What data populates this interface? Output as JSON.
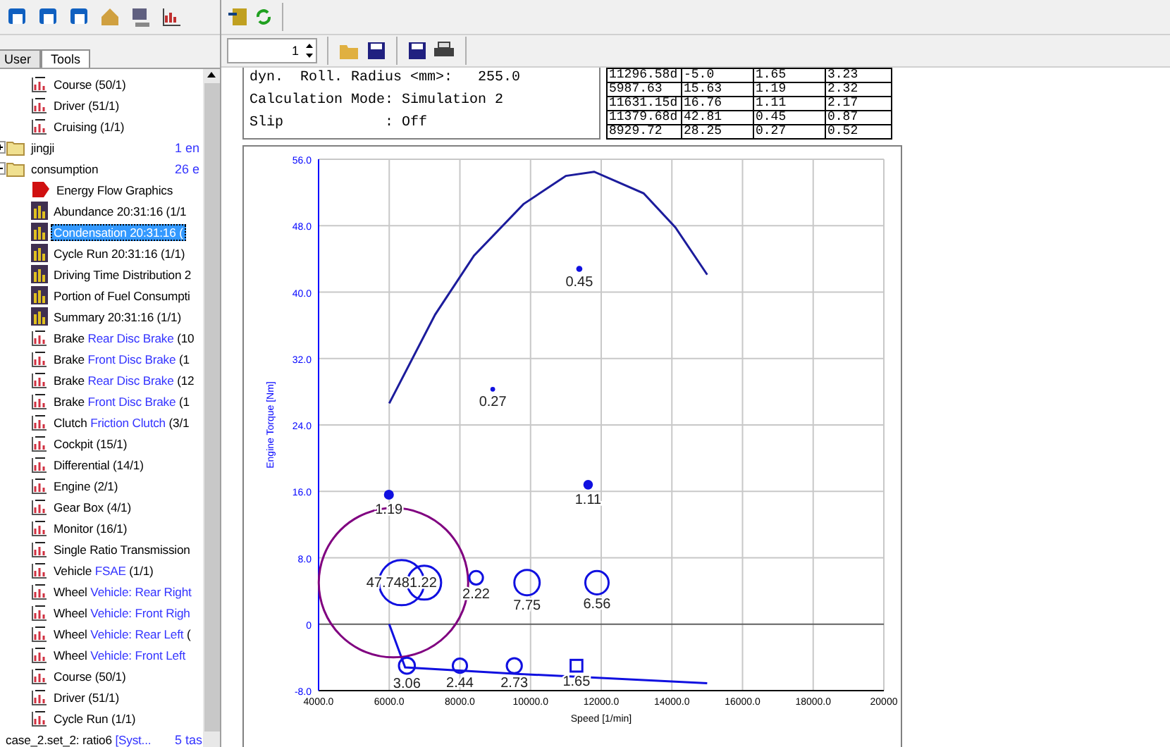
{
  "left_toolbar": {
    "icons": [
      {
        "kind": "new"
      },
      {
        "kind": "copy"
      },
      {
        "kind": "link"
      },
      {
        "kind": "home"
      },
      {
        "kind": "computer"
      },
      {
        "kind": "chart"
      }
    ]
  },
  "tabs": [
    {
      "label": "User",
      "selected": false
    },
    {
      "label": "Tools",
      "selected": true
    }
  ],
  "tree": [
    {
      "kind": "continued",
      "children": [
        {
          "kind": "bin",
          "label": "Course (50/1)",
          "selected": false
        },
        {
          "kind": "bin",
          "label": "Driver (51/1)",
          "selected": false
        },
        {
          "kind": "bin",
          "label": "Cruising (1/1)",
          "selected": false
        }
      ]
    },
    {
      "kind": "folder",
      "label": "jingji",
      "count": "1 en",
      "expanded": false
    },
    {
      "kind": "folder",
      "label": "consumption",
      "count": "26 e",
      "expanded": true,
      "children": [
        {
          "kind": "energy",
          "label": "Energy Flow Graphics",
          "selected": false
        },
        {
          "kind": "report",
          "label": "Abundance 20:31:16 (1/1",
          "selected": false
        },
        {
          "kind": "report",
          "label": "Condensation 20:31:16 (",
          "selected": true
        },
        {
          "kind": "report",
          "label": "Cycle Run 20:31:16 (1/1)",
          "selected": false
        },
        {
          "kind": "report",
          "label": "Driving Time Distribution 2",
          "selected": false
        },
        {
          "kind": "report",
          "label": "Portion of Fuel Consumpti",
          "selected": false
        },
        {
          "kind": "report",
          "label": "Summary 20:31:16 (1/1)",
          "selected": false
        },
        {
          "kind": "bin",
          "label": "Brake",
          "component": "Rear Disc Brake",
          "suffix": "(10",
          "selected": false
        },
        {
          "kind": "bin",
          "label": "Brake",
          "component": "Front Disc Brake",
          "suffix": "(1",
          "selected": false
        },
        {
          "kind": "bin",
          "label": "Brake",
          "component": "Rear Disc Brake",
          "suffix": "(12",
          "selected": false
        },
        {
          "kind": "bin",
          "label": "Brake",
          "component": "Front Disc Brake",
          "suffix": "(1",
          "selected": false
        },
        {
          "kind": "bin",
          "label": "Clutch",
          "component": "Friction Clutch",
          "suffix": "(3/1",
          "selected": false
        },
        {
          "kind": "bin",
          "label": "Cockpit (15/1)",
          "selected": false
        },
        {
          "kind": "bin",
          "label": "Differential (14/1)",
          "selected": false
        },
        {
          "kind": "bin",
          "label": "Engine (2/1)",
          "selected": false
        },
        {
          "kind": "bin",
          "label": "Gear Box (4/1)",
          "selected": false
        },
        {
          "kind": "bin",
          "label": "Monitor (16/1)",
          "selected": false
        },
        {
          "kind": "bin",
          "label": "Single Ratio Transmission",
          "selected": false
        },
        {
          "kind": "bin",
          "label": "Vehicle",
          "component": "FSAE",
          "suffix": "(1/1)",
          "selected": false
        },
        {
          "kind": "bin",
          "label": "Wheel",
          "component": "Vehicle: Rear Right",
          "selected": false
        },
        {
          "kind": "bin",
          "label": "Wheel",
          "component": "Vehicle: Front Righ",
          "selected": false
        },
        {
          "kind": "bin",
          "label": "Wheel",
          "component": "Vehicle: Rear Left",
          "suffix": "(",
          "selected": false
        },
        {
          "kind": "bin",
          "label": "Wheel",
          "component": "Vehicle: Front Left",
          "selected": false
        },
        {
          "kind": "bin",
          "label": "Course (50/1)",
          "selected": false
        },
        {
          "kind": "bin",
          "label": "Driver (51/1)",
          "selected": false
        },
        {
          "kind": "bin",
          "label": "Cycle Run (1/1)",
          "selected": false
        }
      ]
    },
    {
      "kind": "case",
      "label": "case_2.set_2: ratio6",
      "component": "[Syst...",
      "count": "5 tas"
    }
  ],
  "toolbar": {
    "icons": [
      {
        "kind": "import"
      },
      {
        "kind": "refresh"
      }
    ]
  },
  "report_toolbar": {
    "page": "1",
    "icons": [
      {
        "kind": "open"
      },
      {
        "kind": "save"
      },
      {
        "kind": "save"
      },
      {
        "kind": "print"
      }
    ]
  },
  "info_box": {
    "lines": [
      "dyn.  Roll. Radius <mm>:   255.0",
      "Calculation Mode: Simulation 2",
      "Slip            : Off"
    ]
  },
  "table": {
    "rows": [
      [
        "11296.58d",
        "-5.0",
        "1.65",
        "3.23"
      ],
      [
        "5987.63",
        "15.63",
        "1.19",
        "2.32"
      ],
      [
        "11631.15d",
        "16.76",
        "1.11",
        "2.17"
      ],
      [
        "11379.68d",
        "42.81",
        "0.45",
        "0.87"
      ],
      [
        "8929.72",
        "28.25",
        "0.27",
        "0.52"
      ]
    ]
  },
  "chart": {
    "chart_data": {
      "type": "line",
      "xlabel": "Speed [1/min]",
      "ylabel": "Engine Torque [Nm]",
      "xlim": [
        4000,
        20000
      ],
      "ylim": [
        -8,
        56
      ],
      "grid": true,
      "xticks": [
        {
          "value": 4000,
          "label": "4000.0"
        },
        {
          "value": 6000,
          "label": "6000.0"
        },
        {
          "value": 8000,
          "label": "8000.0"
        },
        {
          "value": 10000,
          "label": "10000.0"
        },
        {
          "value": 12000,
          "label": "12000.0"
        },
        {
          "value": 14000,
          "label": "14000.0"
        },
        {
          "value": 16000,
          "label": "16000.0"
        },
        {
          "value": 18000,
          "label": "18000.0"
        },
        {
          "value": 20000,
          "label": "20000"
        }
      ],
      "yticks": [
        {
          "value": -8,
          "label": "-8.0"
        },
        {
          "value": 0,
          "label": "0"
        },
        {
          "value": 8,
          "label": "8.0"
        },
        {
          "value": 16,
          "label": "16.0"
        },
        {
          "value": 24,
          "label": "24.0"
        },
        {
          "value": 32,
          "label": "32.0"
        },
        {
          "value": 40,
          "label": "40.0"
        },
        {
          "value": 48,
          "label": "48.0"
        },
        {
          "value": 56,
          "label": "56.0"
        }
      ],
      "series": [
        {
          "color": "#1c1c9c",
          "x": [
            6000,
            7300,
            8400,
            9800,
            11000,
            11800,
            13200,
            14100,
            15000
          ],
          "values": [
            26.6,
            37.3,
            44.4,
            50.6,
            54,
            54.5,
            51.9,
            47.8,
            42.1
          ]
        },
        {
          "color": "#1010e0",
          "x": [
            6000,
            6450,
            9700,
            15000
          ],
          "values": [
            0,
            -5.2,
            -6,
            -7.1
          ]
        },
        {
          "type": "scatter",
          "color": "#1010e0",
          "x": [
            11380,
            8930,
            11630,
            5990,
            6350,
            6990,
            8460,
            9900,
            11880,
            6500,
            8000,
            9540,
            11300
          ],
          "values": [
            42.8,
            28.3,
            16.8,
            15.6,
            5,
            5,
            5.6,
            5,
            5,
            -5,
            -5,
            -5,
            -5
          ],
          "sizes": [
            0.45,
            0.27,
            1.11,
            1.19,
            null,
            null,
            2.22,
            7.75,
            6.56,
            3.06,
            2.44,
            2.73,
            1.65
          ],
          "value_labels": [
            "0.45",
            "0.27",
            "1.11",
            "1.19",
            "47.7481.22",
            null,
            "2.22",
            "7.75",
            "6.56",
            "3.06",
            "2.44",
            "2.73",
            "1.65"
          ]
        }
      ]
    }
  }
}
